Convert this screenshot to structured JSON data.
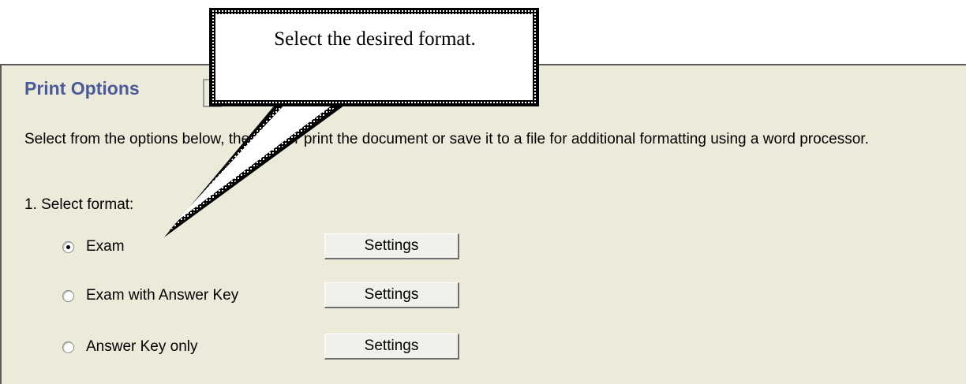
{
  "panel": {
    "title": "Print Options",
    "description": "Select from the options below, then either print the document or save it to a file for additional formatting using a word processor.",
    "step_label": "1.  Select format:",
    "options": [
      {
        "label": "Exam",
        "selected": true,
        "button_label": "Settings"
      },
      {
        "label": "Exam with Answer Key",
        "selected": false,
        "button_label": "Settings"
      },
      {
        "label": "Answer Key only",
        "selected": false,
        "button_label": "Settings"
      }
    ]
  },
  "callout": {
    "text": "Select the desired format."
  },
  "colors": {
    "panel_background": "#ecead9",
    "title_color": "#4a5a9a"
  }
}
